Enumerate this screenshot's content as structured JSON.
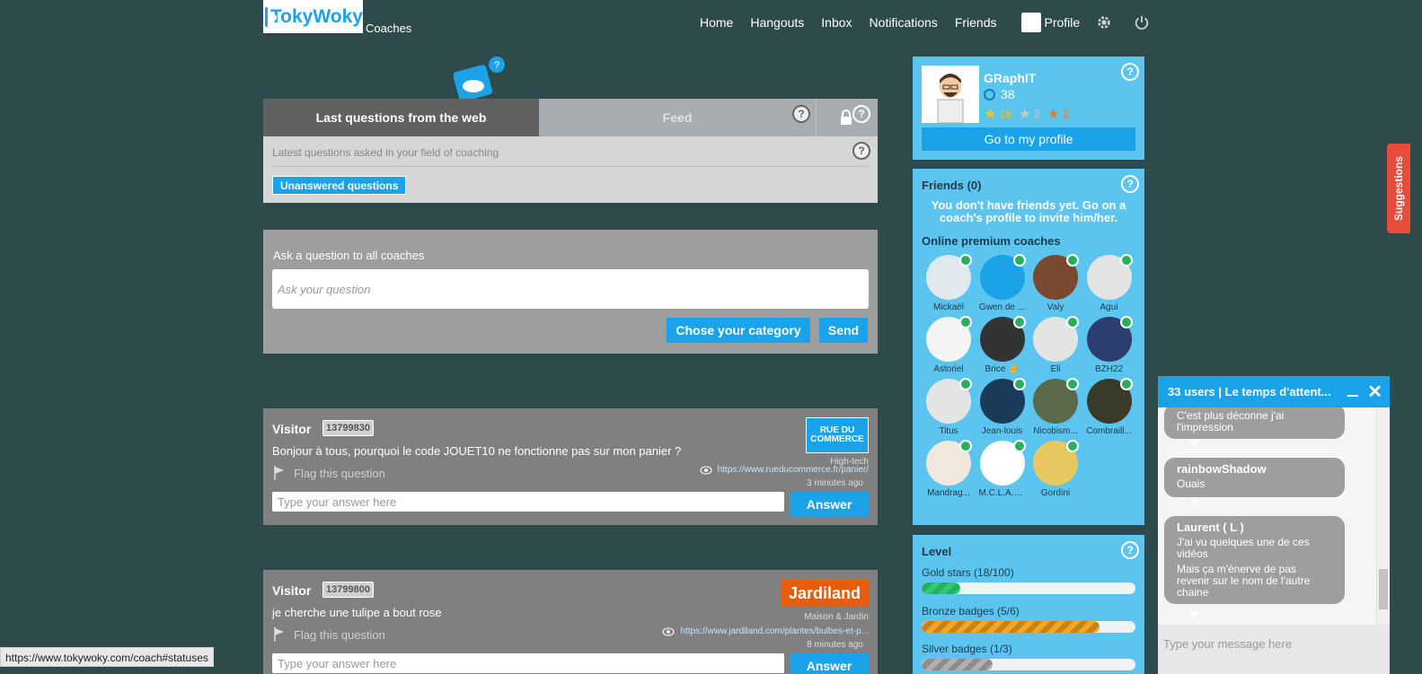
{
  "header": {
    "logo": "TokyWoky",
    "logo_sub": "Coaches",
    "nav": [
      "Home",
      "Hangouts",
      "Inbox",
      "Notifications",
      "Friends"
    ],
    "profile_label": "Profile"
  },
  "tabs": {
    "web": "Last questions from the web",
    "feed": "Feed",
    "help": "?"
  },
  "web_panel": {
    "subtitle": "Latest questions asked in your field of coaching",
    "unanswered": "Unanswered questions"
  },
  "ask": {
    "label": "Ask a question to all coaches",
    "placeholder": "Ask your question",
    "category_button": "Chose your category",
    "send_button": "Send"
  },
  "questions": [
    {
      "visitor": "Visitor",
      "id": "13799830",
      "text": "Bonjour à tous, pourquoi le code JOUET10 ne fonctionne pas sur mon panier ?",
      "flag": "Flag this question",
      "brand": "RUE DU COMMERCE",
      "category": "High-tech",
      "url": "https://www.rueducommerce.fr/panier/",
      "time": "3 minutes ago",
      "answer_placeholder": "Type your answer here",
      "answer_button": "Answer"
    },
    {
      "visitor": "Visitor",
      "id": "13799800",
      "text": "je cherche une tulipe a bout rose",
      "flag": "Flag this question",
      "brand": "Jardiland",
      "category": "Maison & Jardin",
      "url": "https://www.jardiland.com/plantes/bulbes-et-p...",
      "time": "8 minutes ago",
      "answer_placeholder": "Type your answer here",
      "answer_button": "Answer"
    }
  ],
  "profile": {
    "name": "GRaphIT",
    "score": "38",
    "gold": "18",
    "silver": "2",
    "bronze": "2",
    "button": "Go to my profile"
  },
  "friends": {
    "title": "Friends (0)",
    "message": "You don't have friends yet. Go on a coach's profile to invite him/her.",
    "online_title": "Online premium coaches",
    "coaches": [
      "Mickaël",
      "Gwen de ...",
      "Valy",
      "Agui",
      "Astoriel",
      "Brice ✌",
      "Eli",
      "BZH22",
      "Titus",
      "Jean-louis",
      "Nicobism...",
      "Combraill...",
      "Mandrag...",
      "M.C.L.A.S.B.",
      "Gordini"
    ]
  },
  "level": {
    "title": "Level",
    "gold_label": "Gold stars (18/100)",
    "gold_pct": 0.18,
    "bronze_label": "Bronze badges (5/6)",
    "bronze_pct": 0.833,
    "silver_label": "Silver badges (1/3)",
    "silver_pct": 0.333
  },
  "suggestions": "Suggestions",
  "chat": {
    "title": "33 users | Le temps d'attent...",
    "messages": [
      {
        "author": "",
        "text": "C'est plus déconne j'ai l'impression"
      },
      {
        "author": "rainbowShadow",
        "text": "Ouais"
      },
      {
        "author": "Laurent ( L )",
        "text": "J'ai vu quelques une de ces vidéos"
      },
      {
        "author": "",
        "text": "Mais ça m'énerve de pas revenir sur le nom de l'autre chaine"
      }
    ],
    "placeholder": "Type your message here"
  },
  "status_url": "https://www.tokywoky.com/coach#statuses",
  "colors": {
    "accent": "#1aa3e8",
    "sidebar": "#5bc5f0",
    "background": "#2e4a4a",
    "online": "#27ae60",
    "suggestions": "#e74c3c"
  }
}
